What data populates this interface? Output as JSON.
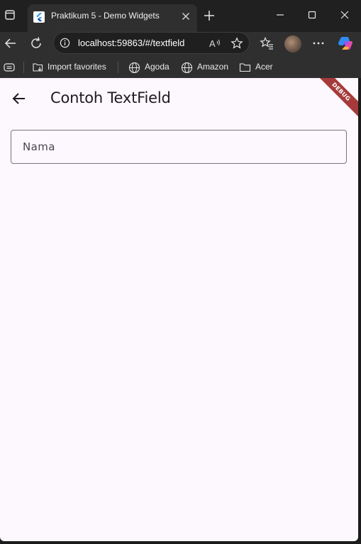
{
  "browser": {
    "tab": {
      "title": "Praktikum 5 - Demo Widgets"
    },
    "address": {
      "url": "localhost:59863/#/textfield"
    },
    "favorites": [
      {
        "label": "Import favorites",
        "icon": "import-icon"
      },
      {
        "label": "Agoda",
        "icon": "globe-icon"
      },
      {
        "label": "Amazon",
        "icon": "globe-icon"
      },
      {
        "label": "Acer",
        "icon": "folder-icon"
      }
    ]
  },
  "app": {
    "appbar": {
      "title": "Contoh TextField"
    },
    "textfield": {
      "label": "Nama",
      "value": ""
    },
    "debug_banner": "DEBUG",
    "colors": {
      "background": "#fdf7fe",
      "text": "#1d1b20",
      "outline": "#79747e",
      "debug": "#a63a3a"
    }
  }
}
